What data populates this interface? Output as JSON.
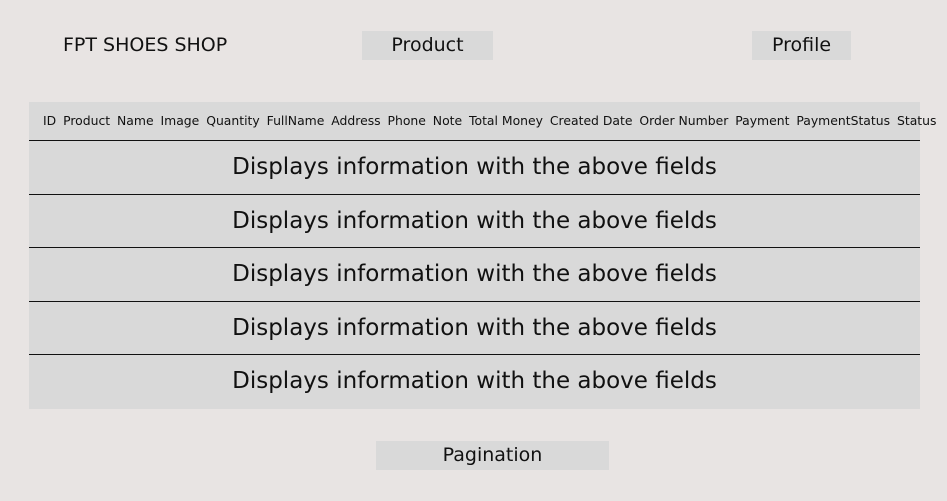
{
  "header": {
    "brand": "FPT SHOES SHOP",
    "nav": {
      "product_label": "Product",
      "profile_label": "Profile"
    }
  },
  "table": {
    "columns": [
      "ID",
      "Product",
      "Name",
      "Image",
      "Quantity",
      "FullName",
      "Address",
      "Phone",
      "Note",
      "Total Money",
      "Created Date",
      "Order Number",
      "Payment",
      "PaymentStatus",
      "Status"
    ],
    "rows": [
      "Displays information with the above fields",
      "Displays information with the above fields",
      "Displays information with the above fields",
      "Displays information with the above fields",
      "Displays information with the above fields"
    ]
  },
  "pagination": {
    "label": "Pagination"
  }
}
